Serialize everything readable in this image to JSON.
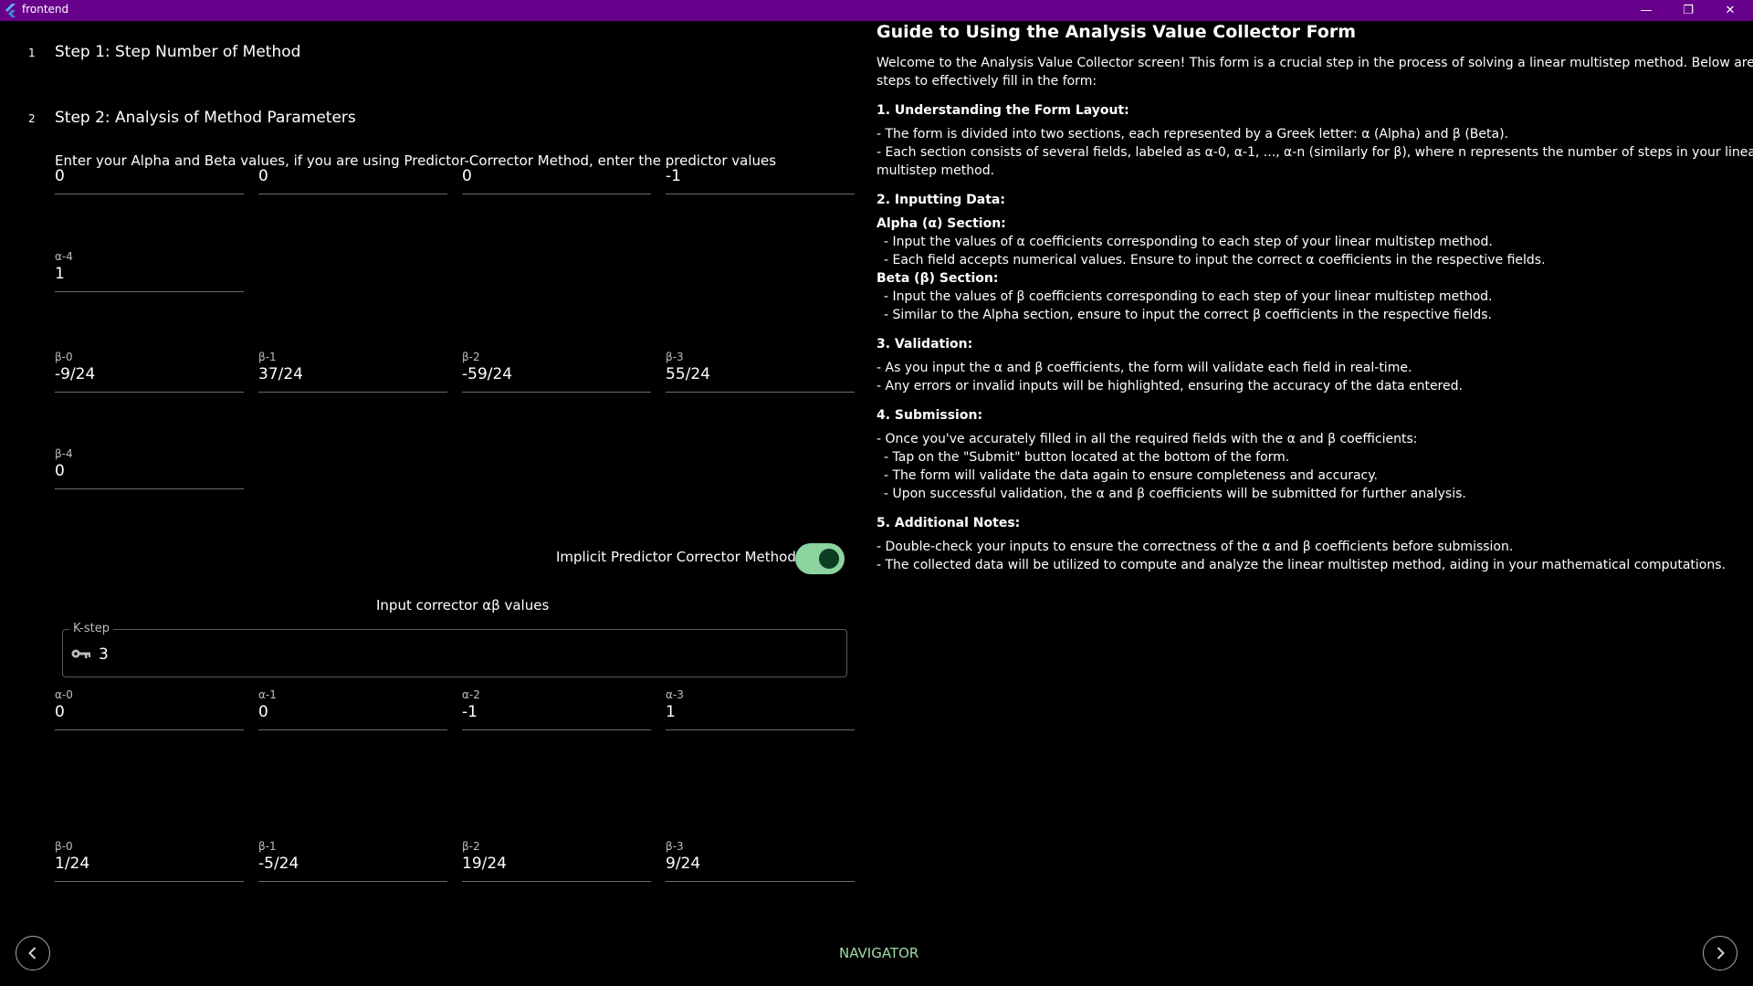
{
  "window": {
    "title": "frontend",
    "titlebar_color": "#67008a",
    "minimize_glyph": "—",
    "maximize_glyph": "❐",
    "close_glyph": "✕"
  },
  "steps": [
    {
      "number": "1",
      "title": "Step 1: Step Number of Method"
    },
    {
      "number": "2",
      "title": "Step 2: Analysis of Method Parameters"
    }
  ],
  "predictor": {
    "instructions": "Enter your Alpha and Beta values, if you are using Predictor-Corrector Method, enter the predictor values",
    "alpha_fields": [
      {
        "label": "",
        "value": "0"
      },
      {
        "label": "",
        "value": "0"
      },
      {
        "label": "",
        "value": "0"
      },
      {
        "label": "",
        "value": "-1"
      },
      {
        "label": "α-4",
        "value": "1"
      }
    ],
    "beta_fields": [
      {
        "label": "β-0",
        "value": "-9/24"
      },
      {
        "label": "β-1",
        "value": "37/24"
      },
      {
        "label": "β-2",
        "value": "-59/24"
      },
      {
        "label": "β-3",
        "value": "55/24"
      },
      {
        "label": "β-4",
        "value": "0"
      }
    ]
  },
  "toggle": {
    "label": "Implicit Predictor Corrector Method:",
    "on": true,
    "color": "#8bd39f"
  },
  "corrector": {
    "title": "Input corrector αβ values",
    "kstep_label": "K-step",
    "kstep_value": "3",
    "kstep_icon": "key-icon",
    "alpha_fields": [
      {
        "label": "α-0",
        "value": "0"
      },
      {
        "label": "α-1",
        "value": "0"
      },
      {
        "label": "α-2",
        "value": "-1"
      },
      {
        "label": "α-3",
        "value": "1"
      }
    ],
    "beta_fields": [
      {
        "label": "β-0",
        "value": "1/24"
      },
      {
        "label": "β-1",
        "value": "-5/24"
      },
      {
        "label": "β-2",
        "value": "19/24"
      },
      {
        "label": "β-3",
        "value": "9/24"
      }
    ]
  },
  "navigator": {
    "label": "NAVIGATOR",
    "color": "#9edba8"
  },
  "guide": {
    "title": "Guide to Using the Analysis Value Collector Form",
    "intro_1": "Welcome to the Analysis Value Collector screen! This form is a crucial step in the process of solving a linear multistep method. Below are the",
    "intro_2": "steps to effectively fill in the form:",
    "s1_head": "1. Understanding the Form Layout:",
    "s1_l1": "- The form is divided into two sections, each represented by a Greek letter: α (Alpha) and β (Beta).",
    "s1_l2": "- Each section consists of several fields, labeled as α-0, α-1, ..., α-n (similarly for β), where n represents the number of steps in your linear",
    "s1_l3": "multistep method.",
    "s2_head": "2. Inputting Data:",
    "s2_alpha_head": "Alpha (α) Section:",
    "s2_alpha_l1": "- Input the values of α coefficients corresponding to each step of your linear multistep method.",
    "s2_alpha_l2": "- Each field accepts numerical values. Ensure to input the correct α coefficients in the respective fields.",
    "s2_beta_head": "Beta (β) Section:",
    "s2_beta_l1": "- Input the values of β coefficients corresponding to each step of your linear multistep method.",
    "s2_beta_l2": "- Similar to the Alpha section, ensure to input the correct β coefficients in the respective fields.",
    "s3_head": "3. Validation:",
    "s3_l1": "- As you input the α and β coefficients, the form will validate each field in real-time.",
    "s3_l2": "- Any errors or invalid inputs will be highlighted, ensuring the accuracy of the data entered.",
    "s4_head": "4. Submission:",
    "s4_l1": "- Once you've accurately filled in all the required fields with the α and β coefficients:",
    "s4_l2": "- Tap on the \"Submit\" button located at the bottom of the form.",
    "s4_l3": "- The form will validate the data again to ensure completeness and accuracy.",
    "s4_l4": "- Upon successful validation, the α and β coefficients will be submitted for further analysis.",
    "s5_head": "5. Additional Notes:",
    "s5_l1": "- Double-check your inputs to ensure the correctness of the α and β coefficients before submission.",
    "s5_l2": "- The collected data will be utilized to compute and analyze the linear multistep method, aiding in your mathematical computations."
  }
}
